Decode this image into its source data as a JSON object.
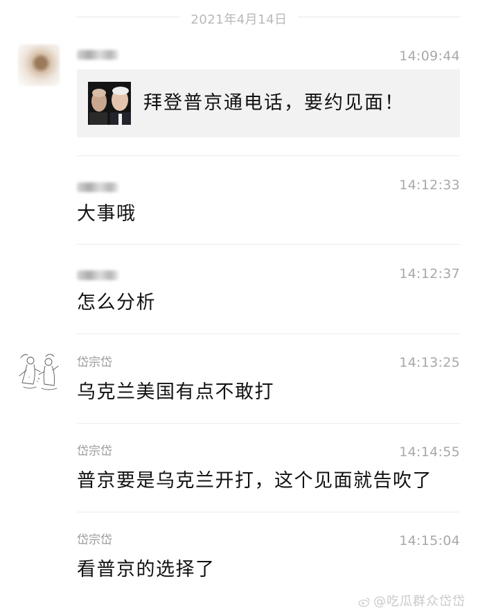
{
  "date_separator": "2021年4月14日",
  "messages": [
    {
      "sender": "",
      "sender_blurred": true,
      "avatar": "blurred-photo-avatar",
      "time": "14:09:44",
      "link_card": {
        "title": "拜登普京通电话，要约见面！",
        "thumbnail": "putin-biden-thumbnail"
      }
    },
    {
      "sender": "",
      "sender_blurred": true,
      "time": "14:12:33",
      "text": "大事哦"
    },
    {
      "sender": "",
      "sender_blurred": true,
      "time": "14:12:37",
      "text": "怎么分析"
    },
    {
      "sender": "岱宗岱",
      "avatar": "sketch-illustration-avatar",
      "time": "14:13:25",
      "text": "乌克兰美国有点不敢打"
    },
    {
      "sender": "岱宗岱",
      "time": "14:14:55",
      "text": "普京要是乌克兰开打，这个见面就告吹了"
    },
    {
      "sender": "岱宗岱",
      "time": "14:15:04",
      "text": "看普京的选择了"
    }
  ],
  "watermark": "@吃瓜群众岱岱",
  "colors": {
    "timestamp": "#a8a8a8",
    "sender": "#9a9a9a",
    "card_background": "#f2f2f2",
    "divider": "#ececec"
  }
}
